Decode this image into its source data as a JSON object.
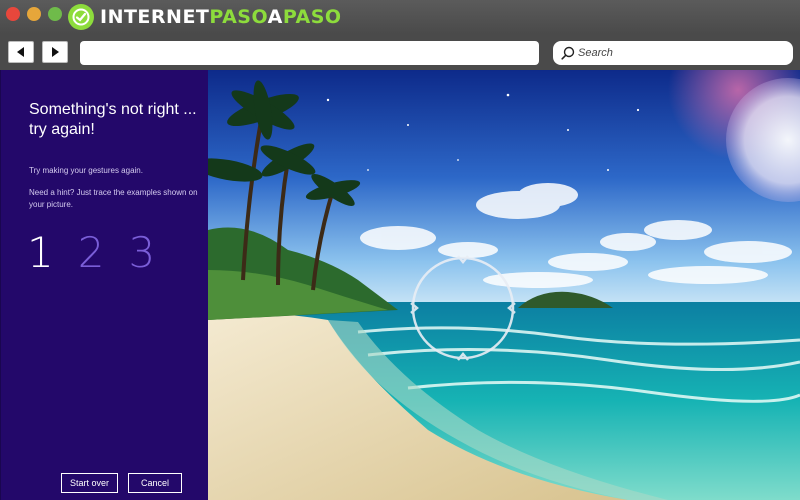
{
  "browser": {
    "brand_part1": "INTERNET",
    "brand_part2": "PASO",
    "brand_part3": "A",
    "brand_part4": "PASO",
    "search_placeholder": "Search",
    "icons": [
      "back-arrow-icon",
      "forward-arrow-icon",
      "search-icon",
      "brand-logo-icon"
    ]
  },
  "panel": {
    "title": "Something's not right ... try again!",
    "instruction": "Try making your gestures again.",
    "hint": "Need a hint? Just trace the examples shown on your picture.",
    "steps": [
      {
        "label": "1",
        "state": "active"
      },
      {
        "label": "2",
        "state": "pending"
      },
      {
        "label": "3",
        "state": "pending"
      }
    ],
    "start_over_label": "Start over",
    "cancel_label": "Cancel"
  },
  "colors": {
    "panel_bg": "#23086a",
    "step_active": "#ffffff",
    "step_pending": "#7a5ed8",
    "brand_green": "#8ddc3c"
  }
}
